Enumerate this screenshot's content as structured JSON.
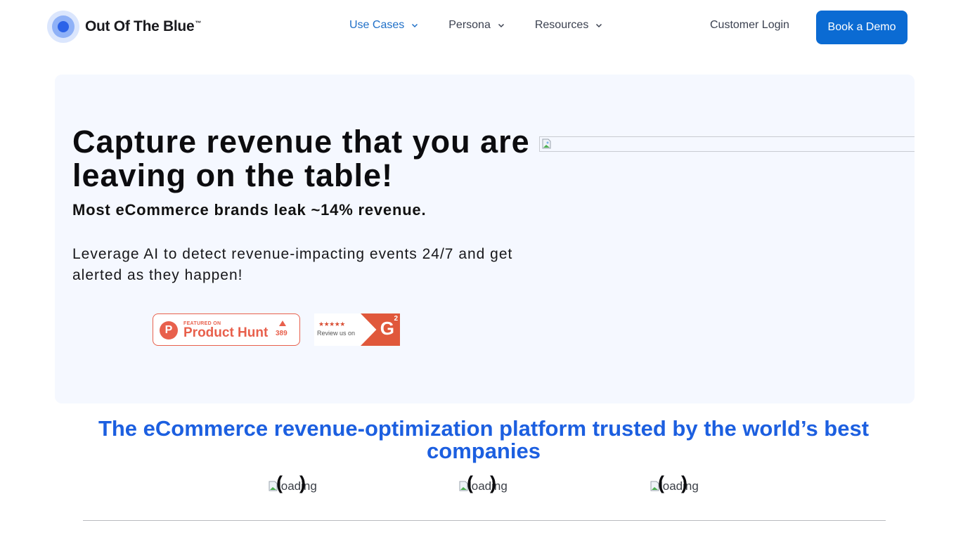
{
  "brand": {
    "name": "Out Of The Blue",
    "trademark": "™"
  },
  "nav": {
    "menu": [
      {
        "label": "Use Cases",
        "icon": "chevron-down-icon",
        "active": true
      },
      {
        "label": "Persona",
        "icon": "chevron-down-icon",
        "active": false
      },
      {
        "label": "Resources",
        "icon": "chevron-down-icon",
        "active": false
      }
    ],
    "login_label": "Customer Login",
    "demo_label": "Book a Demo"
  },
  "hero": {
    "title": "Capture revenue that you are leaving on the table!",
    "subtitle": "Most eCommerce brands leak ~14% revenue.",
    "description": "Leverage AI to detect revenue-impacting events 24/7 and get alerted as they happen!",
    "product_hunt": {
      "featured": "FEATURED ON",
      "name": "Product Hunt",
      "letter": "P",
      "upvotes": "389"
    },
    "g2": {
      "stars": "★★★★★",
      "review": "Review us on",
      "logo": "G",
      "sup": "2"
    },
    "image_icon": "broken-image-icon"
  },
  "trusted": {
    "title": "The eCommerce revenue-optimization platform trusted by the world’s best companies",
    "logos": [
      {
        "alt": "loading"
      },
      {
        "alt": "loading"
      },
      {
        "alt": "loading"
      }
    ]
  },
  "colors": {
    "accent": "#0b6bd3",
    "heading_blue": "#1c5fe0",
    "hero_bg": "#f5f8ff",
    "product_hunt": "#e8604c",
    "g2": "#e0583b"
  }
}
